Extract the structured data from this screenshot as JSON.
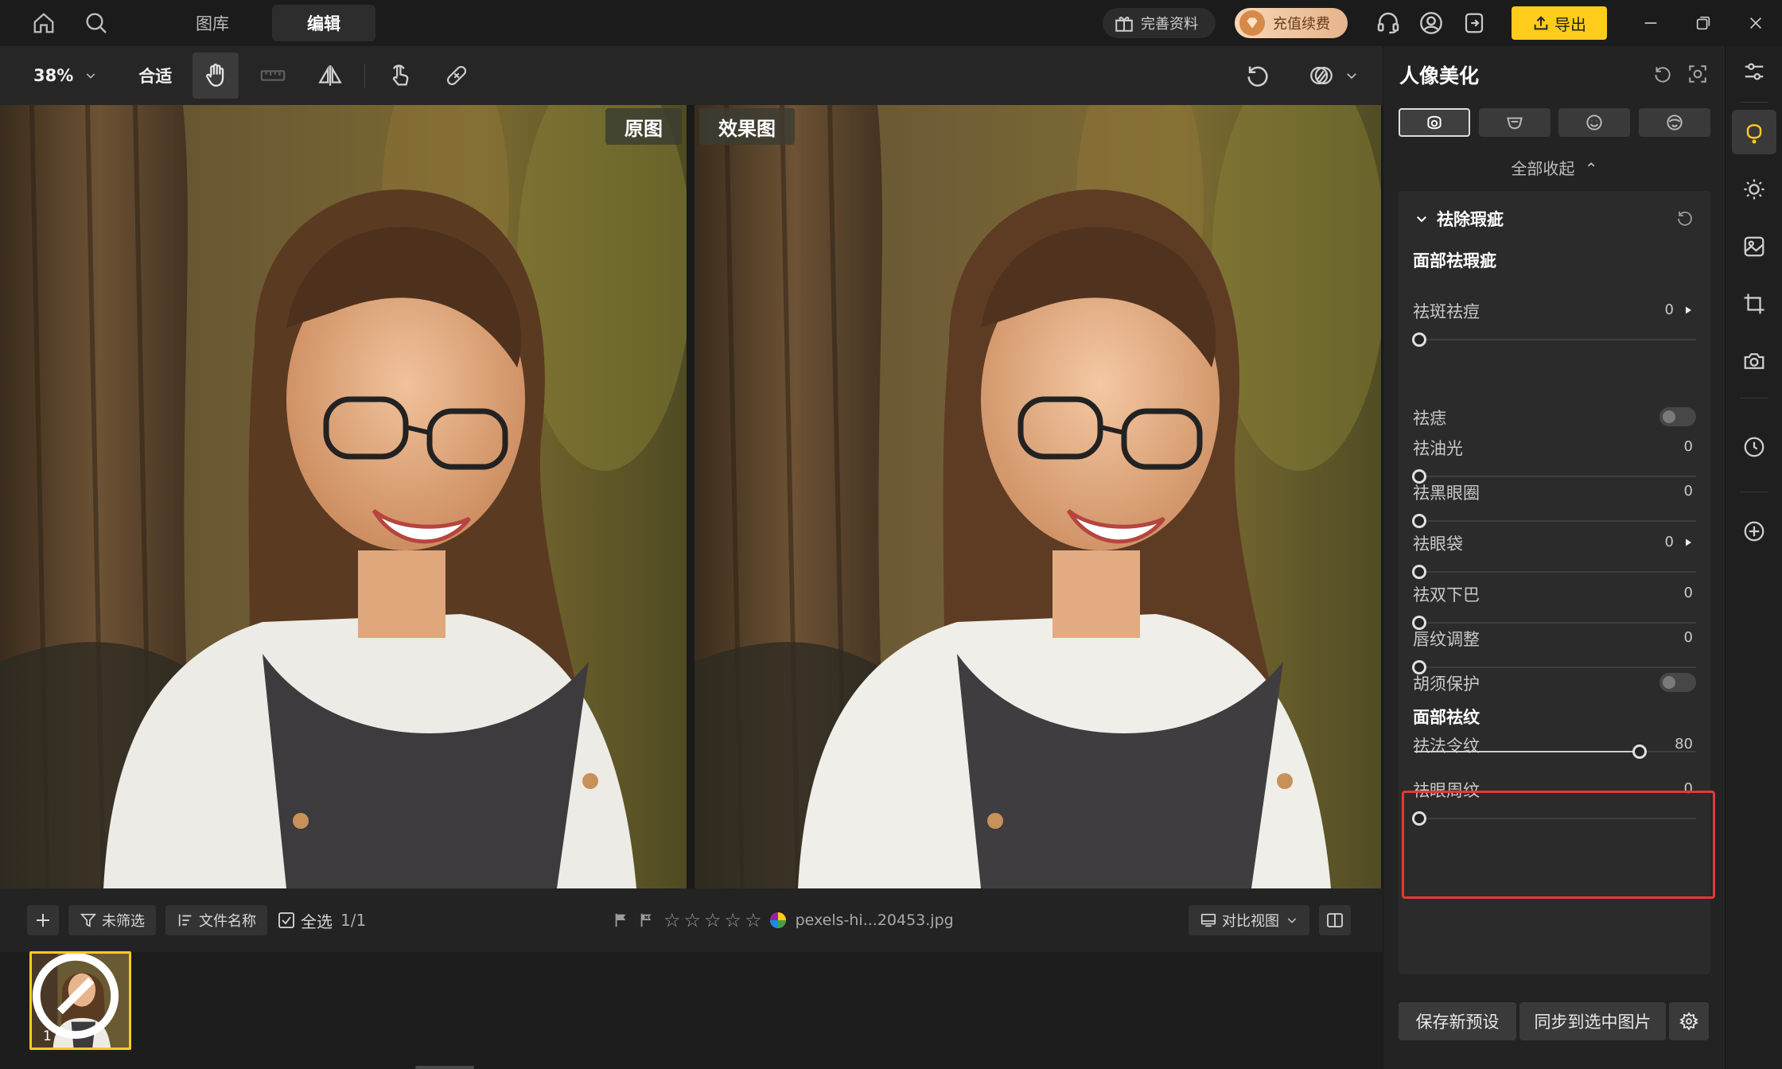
{
  "topbar": {
    "tabs": [
      "图库",
      "编辑"
    ],
    "complete_info": "完善资料",
    "recharge": "充值续费",
    "export": "导出"
  },
  "toolbar": {
    "zoom": "38%",
    "fit": "合适"
  },
  "canvas": {
    "original_label": "原图",
    "effect_label": "效果图"
  },
  "filmbar": {
    "filter": "未筛选",
    "sort": "文件名称",
    "select_all": "全选",
    "count": "1/1",
    "filename": "pexels-hi...20453.jpg",
    "compare_view": "对比视图",
    "stars": 0
  },
  "thumbnail": {
    "index": "1"
  },
  "panel": {
    "title": "人像美化",
    "collapse_all": "全部收起",
    "section_title": "祛除瑕疵",
    "face_blemish_title": "面部祛瑕疵",
    "rows": [
      {
        "label": "祛斑祛痘",
        "value": "0",
        "level": 0
      },
      {
        "label": "祛痣"
      },
      {
        "label": "祛油光",
        "value": "0",
        "level": 0
      },
      {
        "label": "祛黑眼圈",
        "value": "0",
        "level": 0
      },
      {
        "label": "祛眼袋",
        "value": "0",
        "level": 0
      },
      {
        "label": "祛双下巴",
        "value": "0",
        "level": 0
      },
      {
        "label": "唇纹调整",
        "value": "0",
        "level": 0
      },
      {
        "label": "胡须保护"
      }
    ],
    "wrinkle_title": "面部祛纹",
    "wrinkle_rows": [
      {
        "label": "祛法令纹",
        "value": "80",
        "level": 0.8
      },
      {
        "label": "祛眼周纹",
        "value": "0",
        "level": 0
      }
    ],
    "save_preset": "保存新预设",
    "sync": "同步到选中图片"
  },
  "colors": {
    "accent": "#ffcc1b",
    "highlight": "#e53935"
  }
}
